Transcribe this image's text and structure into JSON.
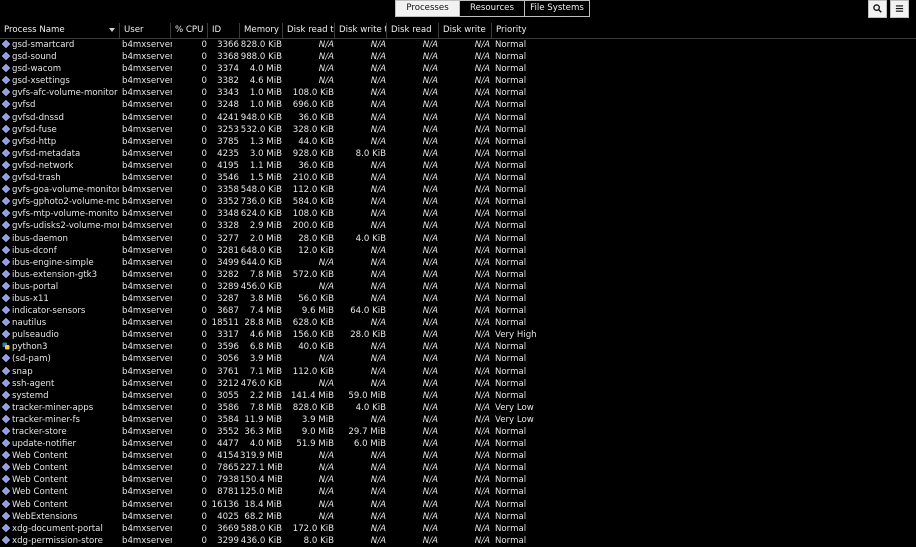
{
  "tabs": [
    {
      "label": "Processes",
      "active": true
    },
    {
      "label": "Resources",
      "active": false
    },
    {
      "label": "File Systems",
      "active": false
    }
  ],
  "toolbar": {
    "search_icon": "search-icon",
    "menu_icon": "hamburger-menu-icon"
  },
  "columns": {
    "name": "Process Name",
    "user": "User",
    "cpu": "% CPU",
    "id": "ID",
    "memory": "Memory",
    "disk_read_total": "Disk read tot",
    "disk_write_total": "Disk write to",
    "disk_read": "Disk read",
    "disk_write": "Disk write",
    "priority": "Priority"
  },
  "colors": {
    "background": "#000000",
    "text": "#e6e6e6",
    "icon_diamond": "#8f9ae8",
    "icon_python": "#3b77a8"
  },
  "processes": [
    {
      "name": "gsd-smartcard",
      "user": "b4mxserver",
      "cpu": "0",
      "id": "3366",
      "mem": "828.0 KiB",
      "drt": "N/A",
      "dwt": "N/A",
      "dr": "N/A",
      "dw": "N/A",
      "pri": "Normal",
      "icon": "diamond"
    },
    {
      "name": "gsd-sound",
      "user": "b4mxserver",
      "cpu": "0",
      "id": "3368",
      "mem": "988.0 KiB",
      "drt": "N/A",
      "dwt": "N/A",
      "dr": "N/A",
      "dw": "N/A",
      "pri": "Normal",
      "icon": "diamond"
    },
    {
      "name": "gsd-wacom",
      "user": "b4mxserver",
      "cpu": "0",
      "id": "3374",
      "mem": "4.0 MiB",
      "drt": "N/A",
      "dwt": "N/A",
      "dr": "N/A",
      "dw": "N/A",
      "pri": "Normal",
      "icon": "diamond"
    },
    {
      "name": "gsd-xsettings",
      "user": "b4mxserver",
      "cpu": "0",
      "id": "3382",
      "mem": "4.6 MiB",
      "drt": "N/A",
      "dwt": "N/A",
      "dr": "N/A",
      "dw": "N/A",
      "pri": "Normal",
      "icon": "diamond"
    },
    {
      "name": "gvfs-afc-volume-monitor",
      "user": "b4mxserver",
      "cpu": "0",
      "id": "3343",
      "mem": "1.0 MiB",
      "drt": "108.0 KiB",
      "dwt": "N/A",
      "dr": "N/A",
      "dw": "N/A",
      "pri": "Normal",
      "icon": "diamond"
    },
    {
      "name": "gvfsd",
      "user": "b4mxserver",
      "cpu": "0",
      "id": "3248",
      "mem": "1.0 MiB",
      "drt": "696.0 KiB",
      "dwt": "N/A",
      "dr": "N/A",
      "dw": "N/A",
      "pri": "Normal",
      "icon": "diamond"
    },
    {
      "name": "gvfsd-dnssd",
      "user": "b4mxserver",
      "cpu": "0",
      "id": "4241",
      "mem": "948.0 KiB",
      "drt": "36.0 KiB",
      "dwt": "N/A",
      "dr": "N/A",
      "dw": "N/A",
      "pri": "Normal",
      "icon": "diamond"
    },
    {
      "name": "gvfsd-fuse",
      "user": "b4mxserver",
      "cpu": "0",
      "id": "3253",
      "mem": "532.0 KiB",
      "drt": "328.0 KiB",
      "dwt": "N/A",
      "dr": "N/A",
      "dw": "N/A",
      "pri": "Normal",
      "icon": "diamond"
    },
    {
      "name": "gvfsd-http",
      "user": "b4mxserver",
      "cpu": "0",
      "id": "3785",
      "mem": "1.3 MiB",
      "drt": "44.0 KiB",
      "dwt": "N/A",
      "dr": "N/A",
      "dw": "N/A",
      "pri": "Normal",
      "icon": "diamond"
    },
    {
      "name": "gvfsd-metadata",
      "user": "b4mxserver",
      "cpu": "0",
      "id": "4235",
      "mem": "3.0 MiB",
      "drt": "928.0 KiB",
      "dwt": "8.0 KiB",
      "dr": "N/A",
      "dw": "N/A",
      "pri": "Normal",
      "icon": "diamond"
    },
    {
      "name": "gvfsd-network",
      "user": "b4mxserver",
      "cpu": "0",
      "id": "4195",
      "mem": "1.1 MiB",
      "drt": "36.0 KiB",
      "dwt": "N/A",
      "dr": "N/A",
      "dw": "N/A",
      "pri": "Normal",
      "icon": "diamond"
    },
    {
      "name": "gvfsd-trash",
      "user": "b4mxserver",
      "cpu": "0",
      "id": "3546",
      "mem": "1.5 MiB",
      "drt": "210.0 KiB",
      "dwt": "N/A",
      "dr": "N/A",
      "dw": "N/A",
      "pri": "Normal",
      "icon": "diamond"
    },
    {
      "name": "gvfs-goa-volume-monitor",
      "user": "b4mxserver",
      "cpu": "0",
      "id": "3358",
      "mem": "548.0 KiB",
      "drt": "112.0 KiB",
      "dwt": "N/A",
      "dr": "N/A",
      "dw": "N/A",
      "pri": "Normal",
      "icon": "diamond"
    },
    {
      "name": "gvfs-gphoto2-volume-monito",
      "user": "b4mxserver",
      "cpu": "0",
      "id": "3352",
      "mem": "736.0 KiB",
      "drt": "584.0 KiB",
      "dwt": "N/A",
      "dr": "N/A",
      "dw": "N/A",
      "pri": "Normal",
      "icon": "diamond"
    },
    {
      "name": "gvfs-mtp-volume-monitor",
      "user": "b4mxserver",
      "cpu": "0",
      "id": "3348",
      "mem": "624.0 KiB",
      "drt": "108.0 KiB",
      "dwt": "N/A",
      "dr": "N/A",
      "dw": "N/A",
      "pri": "Normal",
      "icon": "diamond"
    },
    {
      "name": "gvfs-udisks2-volume-monitor",
      "user": "b4mxserver",
      "cpu": "0",
      "id": "3328",
      "mem": "2.9 MiB",
      "drt": "200.0 KiB",
      "dwt": "N/A",
      "dr": "N/A",
      "dw": "N/A",
      "pri": "Normal",
      "icon": "diamond"
    },
    {
      "name": "ibus-daemon",
      "user": "b4mxserver",
      "cpu": "0",
      "id": "3277",
      "mem": "2.0 MiB",
      "drt": "28.0 KiB",
      "dwt": "4.0 KiB",
      "dr": "N/A",
      "dw": "N/A",
      "pri": "Normal",
      "icon": "diamond"
    },
    {
      "name": "ibus-dconf",
      "user": "b4mxserver",
      "cpu": "0",
      "id": "3281",
      "mem": "648.0 KiB",
      "drt": "12.0 KiB",
      "dwt": "N/A",
      "dr": "N/A",
      "dw": "N/A",
      "pri": "Normal",
      "icon": "diamond"
    },
    {
      "name": "ibus-engine-simple",
      "user": "b4mxserver",
      "cpu": "0",
      "id": "3499",
      "mem": "644.0 KiB",
      "drt": "N/A",
      "dwt": "N/A",
      "dr": "N/A",
      "dw": "N/A",
      "pri": "Normal",
      "icon": "diamond"
    },
    {
      "name": "ibus-extension-gtk3",
      "user": "b4mxserver",
      "cpu": "0",
      "id": "3282",
      "mem": "7.8 MiB",
      "drt": "572.0 KiB",
      "dwt": "N/A",
      "dr": "N/A",
      "dw": "N/A",
      "pri": "Normal",
      "icon": "diamond"
    },
    {
      "name": "ibus-portal",
      "user": "b4mxserver",
      "cpu": "0",
      "id": "3289",
      "mem": "456.0 KiB",
      "drt": "N/A",
      "dwt": "N/A",
      "dr": "N/A",
      "dw": "N/A",
      "pri": "Normal",
      "icon": "diamond"
    },
    {
      "name": "ibus-x11",
      "user": "b4mxserver",
      "cpu": "0",
      "id": "3287",
      "mem": "3.8 MiB",
      "drt": "56.0 KiB",
      "dwt": "N/A",
      "dr": "N/A",
      "dw": "N/A",
      "pri": "Normal",
      "icon": "diamond"
    },
    {
      "name": "indicator-sensors",
      "user": "b4mxserver",
      "cpu": "0",
      "id": "3687",
      "mem": "7.4 MiB",
      "drt": "9.6 MiB",
      "dwt": "64.0 KiB",
      "dr": "N/A",
      "dw": "N/A",
      "pri": "Normal",
      "icon": "diamond"
    },
    {
      "name": "nautilus",
      "user": "b4mxserver",
      "cpu": "0",
      "id": "18511",
      "mem": "28.8 MiB",
      "drt": "628.0 KiB",
      "dwt": "N/A",
      "dr": "N/A",
      "dw": "N/A",
      "pri": "Normal",
      "icon": "diamond"
    },
    {
      "name": "pulseaudio",
      "user": "b4mxserver",
      "cpu": "0",
      "id": "3317",
      "mem": "4.6 MiB",
      "drt": "156.0 KiB",
      "dwt": "28.0 KiB",
      "dr": "N/A",
      "dw": "N/A",
      "pri": "Very High",
      "icon": "diamond"
    },
    {
      "name": "python3",
      "user": "b4mxserver",
      "cpu": "0",
      "id": "3596",
      "mem": "6.8 MiB",
      "drt": "40.0 KiB",
      "dwt": "N/A",
      "dr": "N/A",
      "dw": "N/A",
      "pri": "Normal",
      "icon": "python"
    },
    {
      "name": "(sd-pam)",
      "user": "b4mxserver",
      "cpu": "0",
      "id": "3056",
      "mem": "3.9 MiB",
      "drt": "N/A",
      "dwt": "N/A",
      "dr": "N/A",
      "dw": "N/A",
      "pri": "Normal",
      "icon": "diamond"
    },
    {
      "name": "snap",
      "user": "b4mxserver",
      "cpu": "0",
      "id": "3761",
      "mem": "7.1 MiB",
      "drt": "112.0 KiB",
      "dwt": "N/A",
      "dr": "N/A",
      "dw": "N/A",
      "pri": "Normal",
      "icon": "diamond"
    },
    {
      "name": "ssh-agent",
      "user": "b4mxserver",
      "cpu": "0",
      "id": "3212",
      "mem": "476.0 KiB",
      "drt": "N/A",
      "dwt": "N/A",
      "dr": "N/A",
      "dw": "N/A",
      "pri": "Normal",
      "icon": "diamond"
    },
    {
      "name": "systemd",
      "user": "b4mxserver",
      "cpu": "0",
      "id": "3055",
      "mem": "2.2 MiB",
      "drt": "141.4 MiB",
      "dwt": "59.0 MiB",
      "dr": "N/A",
      "dw": "N/A",
      "pri": "Normal",
      "icon": "diamond"
    },
    {
      "name": "tracker-miner-apps",
      "user": "b4mxserver",
      "cpu": "0",
      "id": "3586",
      "mem": "7.8 MiB",
      "drt": "828.0 KiB",
      "dwt": "4.0 KiB",
      "dr": "N/A",
      "dw": "N/A",
      "pri": "Very Low",
      "icon": "diamond"
    },
    {
      "name": "tracker-miner-fs",
      "user": "b4mxserver",
      "cpu": "0",
      "id": "3584",
      "mem": "11.9 MiB",
      "drt": "3.9 MiB",
      "dwt": "N/A",
      "dr": "N/A",
      "dw": "N/A",
      "pri": "Very Low",
      "icon": "diamond"
    },
    {
      "name": "tracker-store",
      "user": "b4mxserver",
      "cpu": "0",
      "id": "3552",
      "mem": "36.3 MiB",
      "drt": "9.0 MiB",
      "dwt": "29.7 MiB",
      "dr": "N/A",
      "dw": "N/A",
      "pri": "Normal",
      "icon": "diamond"
    },
    {
      "name": "update-notifier",
      "user": "b4mxserver",
      "cpu": "0",
      "id": "4477",
      "mem": "4.0 MiB",
      "drt": "51.9 MiB",
      "dwt": "6.0 MiB",
      "dr": "N/A",
      "dw": "N/A",
      "pri": "Normal",
      "icon": "diamond"
    },
    {
      "name": "Web Content",
      "user": "b4mxserver",
      "cpu": "0",
      "id": "4154",
      "mem": "319.9 MiB",
      "drt": "N/A",
      "dwt": "N/A",
      "dr": "N/A",
      "dw": "N/A",
      "pri": "Normal",
      "icon": "diamond"
    },
    {
      "name": "Web Content",
      "user": "b4mxserver",
      "cpu": "0",
      "id": "7865",
      "mem": "227.1 MiB",
      "drt": "N/A",
      "dwt": "N/A",
      "dr": "N/A",
      "dw": "N/A",
      "pri": "Normal",
      "icon": "diamond"
    },
    {
      "name": "Web Content",
      "user": "b4mxserver",
      "cpu": "0",
      "id": "7938",
      "mem": "150.4 MiB",
      "drt": "N/A",
      "dwt": "N/A",
      "dr": "N/A",
      "dw": "N/A",
      "pri": "Normal",
      "icon": "diamond"
    },
    {
      "name": "Web Content",
      "user": "b4mxserver",
      "cpu": "0",
      "id": "8781",
      "mem": "125.0 MiB",
      "drt": "N/A",
      "dwt": "N/A",
      "dr": "N/A",
      "dw": "N/A",
      "pri": "Normal",
      "icon": "diamond"
    },
    {
      "name": "Web Content",
      "user": "b4mxserver",
      "cpu": "0",
      "id": "16136",
      "mem": "18.4 MiB",
      "drt": "N/A",
      "dwt": "N/A",
      "dr": "N/A",
      "dw": "N/A",
      "pri": "Normal",
      "icon": "diamond"
    },
    {
      "name": "WebExtensions",
      "user": "b4mxserver",
      "cpu": "0",
      "id": "4025",
      "mem": "68.2 MiB",
      "drt": "N/A",
      "dwt": "N/A",
      "dr": "N/A",
      "dw": "N/A",
      "pri": "Normal",
      "icon": "diamond"
    },
    {
      "name": "xdg-document-portal",
      "user": "b4mxserver",
      "cpu": "0",
      "id": "3669",
      "mem": "588.0 KiB",
      "drt": "172.0 KiB",
      "dwt": "N/A",
      "dr": "N/A",
      "dw": "N/A",
      "pri": "Normal",
      "icon": "diamond"
    },
    {
      "name": "xdg-permission-store",
      "user": "b4mxserver",
      "cpu": "0",
      "id": "3299",
      "mem": "436.0 KiB",
      "drt": "8.0 KiB",
      "dwt": "N/A",
      "dr": "N/A",
      "dw": "N/A",
      "pri": "Normal",
      "icon": "diamond"
    }
  ]
}
